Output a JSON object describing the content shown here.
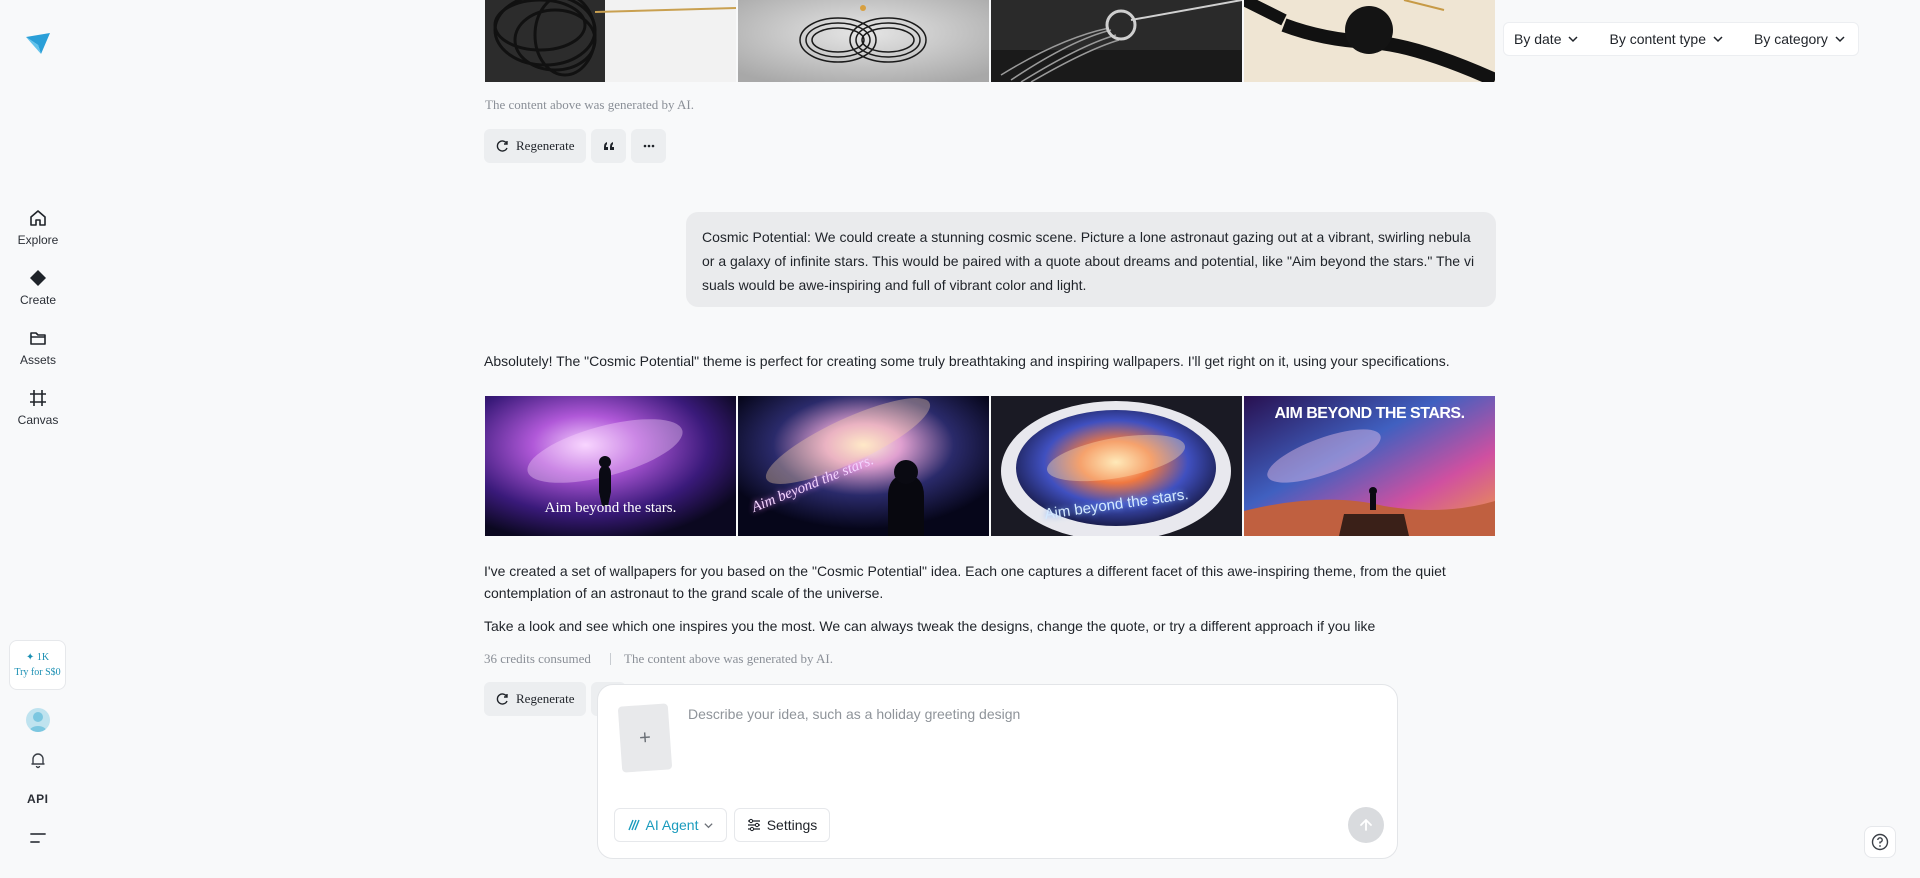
{
  "sidebar": {
    "items": [
      {
        "label": "Explore",
        "icon": "home-icon"
      },
      {
        "label": "Create",
        "icon": "diamond-icon"
      },
      {
        "label": "Assets",
        "icon": "folder-icon"
      },
      {
        "label": "Canvas",
        "icon": "canvas-frame-icon"
      }
    ],
    "credits_amount": "✦ 1K",
    "credits_offer": "Try for S$0",
    "api_label": "API"
  },
  "filters": {
    "by_date": "By date",
    "by_content_type": "By content type",
    "by_category": "By category"
  },
  "first_reply": {
    "ai_note": "The content above was generated by AI.",
    "regenerate_label": "Regenerate"
  },
  "user_message": {
    "text": "Cosmic Potential: We could create a stunning cosmic scene. Picture a lone astronaut gazing out at a vibrant, swirling nebula or a galaxy of infinite stars. This would be paired with a quote about dreams and potential, like \"Aim beyond the stars.\" The visuals would be awe-inspiring and full of vibrant color and light."
  },
  "second_reply": {
    "intro": "Absolutely! The \"Cosmic Potential\" theme is perfect for creating some truly breathtaking and inspiring wallpapers. I'll get right on it, using your specifications.",
    "images": [
      {
        "caption": "Aim beyond the stars."
      },
      {
        "caption": "Aim beyond the stars."
      },
      {
        "caption": "Aim beyond the stars."
      },
      {
        "caption": "AIM BEYOND THE STARS."
      }
    ],
    "para1": "I've created a set of wallpapers for you based on the \"Cosmic Potential\" idea. Each one captures a different facet of this awe-inspiring theme, from the quiet contemplation of an astronaut to the grand scale of the universe.",
    "para2": "Take a look and see which one inspires you the most. We can always tweak the designs, change the quote, or try a different approach if you like",
    "credits_consumed": "36 credits consumed",
    "ai_note": "The content above was generated by AI.",
    "regenerate_label": "Regenerate"
  },
  "composer": {
    "placeholder": "Describe your idea, such as a holiday greeting design",
    "agent_label": "AI Agent",
    "settings_label": "Settings"
  },
  "colors": {
    "accent": "#1a9bbd",
    "background": "#f8f9fa"
  }
}
